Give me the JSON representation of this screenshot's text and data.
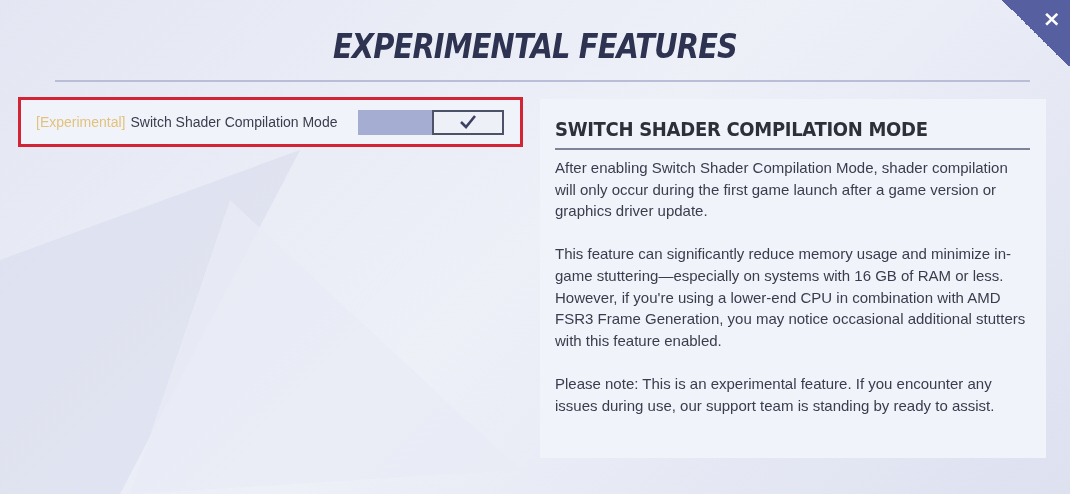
{
  "title": "EXPERIMENTAL FEATURES",
  "close_button": {
    "label": "×"
  },
  "settings": [
    {
      "tag": "[Experimental]",
      "label": "Switch Shader Compilation Mode",
      "on": true,
      "highlighted": true
    }
  ],
  "info_panel": {
    "heading": "SWITCH SHADER COMPILATION MODE",
    "paragraphs": [
      "After enabling Switch Shader Compilation Mode, shader compilation will only occur during the first game launch after a game version or graphics driver update.",
      "This feature can significantly reduce memory usage and minimize in-game stuttering—especially on systems with 16 GB of RAM or less. However, if you're using a lower-end CPU in combination with AMD FSR3 Frame Generation, you may notice occasional additional stutters with this feature enabled.",
      "Please note: This is an experimental feature. If you encounter any issues during use, our support team is standing by ready to assist."
    ]
  }
}
